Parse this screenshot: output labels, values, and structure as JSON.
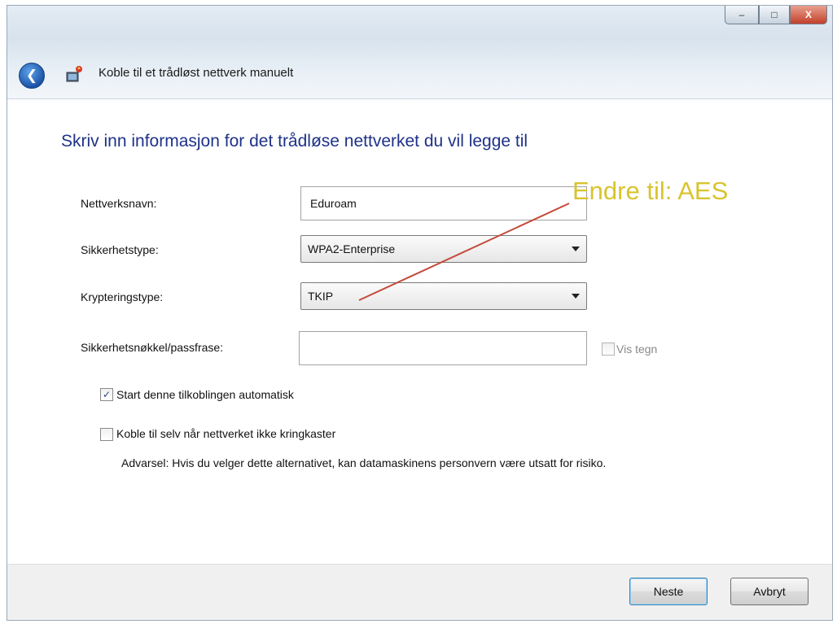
{
  "window": {
    "title": "Koble til et trådløst nettverk manuelt",
    "buttons": {
      "minimize": "–",
      "maximize": "□",
      "close": "X"
    }
  },
  "heading": "Skriv inn informasjon for det trådløse nettverket du vil legge til",
  "form": {
    "network_name": {
      "label": "Nettverksnavn:",
      "value": "Eduroam"
    },
    "security_type": {
      "label": "Sikkerhetstype:",
      "value": "WPA2-Enterprise"
    },
    "encryption_type": {
      "label": "Krypteringstype:",
      "value": "TKIP"
    },
    "security_key": {
      "label": "Sikkerhetsnøkkel/passfrase:",
      "value": ""
    },
    "show_chars": {
      "label": "Vis tegn",
      "checked": false
    }
  },
  "options": {
    "auto_start": {
      "label": "Start denne tilkoblingen automatisk",
      "checked": true,
      "mark": "✓"
    },
    "connect_hidden": {
      "label": "Koble til selv når nettverket ikke kringkaster",
      "checked": false,
      "warning": "Advarsel: Hvis du velger dette alternativet, kan datamaskinens personvern være utsatt for risiko."
    }
  },
  "annotation": {
    "text": "Endre til: AES",
    "color": "#d8c430",
    "line_color": "#c44a3a"
  },
  "footer": {
    "next_label": "Neste",
    "cancel_label": "Avbryt"
  },
  "colors": {
    "heading": "#1e3287",
    "back_button": "#1c54a8"
  },
  "icons": {
    "back": "back-arrow-icon",
    "app": "network-setup-icon"
  }
}
